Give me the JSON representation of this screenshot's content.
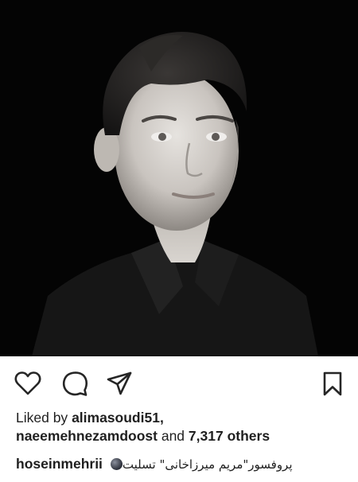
{
  "post": {
    "photo": {
      "subject": "black-and-white portrait"
    },
    "actions": {
      "like_icon": "heart-outline-icon",
      "comment_icon": "comment-bubble-icon",
      "share_icon": "paper-plane-icon",
      "save_icon": "bookmark-outline-icon"
    },
    "likes": {
      "prefix": "Liked by",
      "user1": "alimasoudi51,",
      "user2": "naeemehnezamdoost",
      "conjunction": "and",
      "count": "7,317 others"
    },
    "caption": {
      "username": "hoseinmehrii",
      "text": "پروفسور\"مریم میرزاخانی\" تسلیت"
    },
    "colors": {
      "photo_background": "#040404",
      "text": "#1f1f1f",
      "icon": "#262626"
    }
  }
}
